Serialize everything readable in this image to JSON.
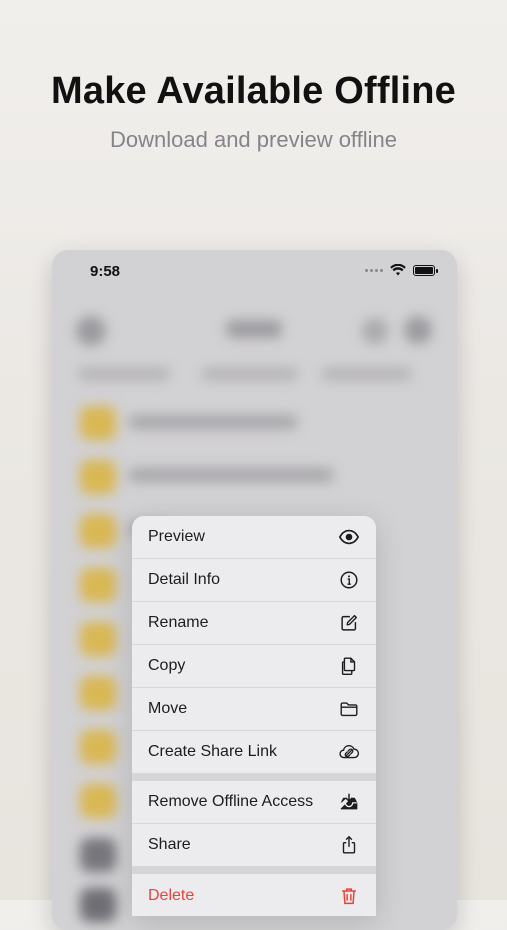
{
  "promo": {
    "headline": "Make Available Offline",
    "subline": "Download and preview offline"
  },
  "status_bar": {
    "time": "9:58",
    "icons": [
      "signal-dots-icon",
      "wifi-icon",
      "battery-icon"
    ]
  },
  "context_menu": {
    "group_primary": [
      {
        "label": "Preview",
        "icon": "eye-icon"
      },
      {
        "label": "Detail Info",
        "icon": "info-circle-icon"
      },
      {
        "label": "Rename",
        "icon": "edit-icon"
      },
      {
        "label": "Copy",
        "icon": "copy-icon"
      },
      {
        "label": "Move",
        "icon": "folder-icon"
      },
      {
        "label": "Create Share Link",
        "icon": "link-cloud-icon"
      }
    ],
    "group_secondary": [
      {
        "label": "Remove Offline Access",
        "icon": "tray-download-icon"
      },
      {
        "label": "Share",
        "icon": "share-icon"
      }
    ],
    "group_danger": [
      {
        "label": "Delete",
        "icon": "trash-icon",
        "color": "#e8433a"
      }
    ]
  },
  "colors": {
    "folder": "#d9b753",
    "danger": "#e8433a",
    "menu_background": "#ecebed"
  }
}
